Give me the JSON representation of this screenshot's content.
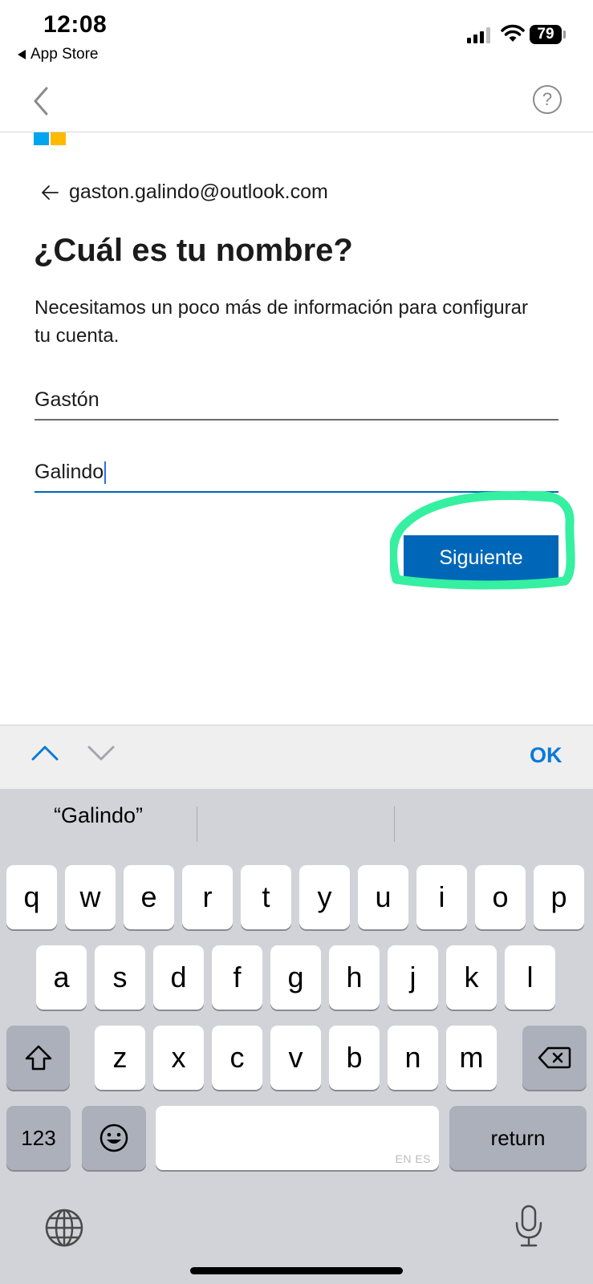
{
  "status_bar": {
    "time": "12:08",
    "back_app_label": "App Store",
    "battery": "79"
  },
  "nav": {
    "back_icon": "chevron-left-icon",
    "help_icon": "question-circle-icon",
    "help_glyph": "?"
  },
  "brand": {
    "name": "Microsoft",
    "logo_colors": [
      "#f25022",
      "#7fba00",
      "#00a4ef",
      "#ffb900"
    ]
  },
  "account": {
    "email": "gaston.galindo@outlook.com"
  },
  "form": {
    "title": "¿Cuál es tu nombre?",
    "description": "Necesitamos un poco más de información para configurar tu cuenta.",
    "first_name": "Gastón",
    "last_name": "Galindo",
    "next_label": "Siguiente"
  },
  "accessory_bar": {
    "ok_label": "OK"
  },
  "keyboard": {
    "suggestions": [
      "“Galindo”",
      "",
      ""
    ],
    "row1": [
      "q",
      "w",
      "e",
      "r",
      "t",
      "y",
      "u",
      "i",
      "o",
      "p"
    ],
    "row2": [
      "a",
      "s",
      "d",
      "f",
      "g",
      "h",
      "j",
      "k",
      "l"
    ],
    "row3": [
      "z",
      "x",
      "c",
      "v",
      "b",
      "n",
      "m"
    ],
    "numbers_label": "123",
    "space_lang": "EN ES",
    "return_label": "return"
  },
  "colors": {
    "accent": "#0067b8",
    "highlight": "#35f0a0",
    "ok": "#0a7ad6"
  }
}
